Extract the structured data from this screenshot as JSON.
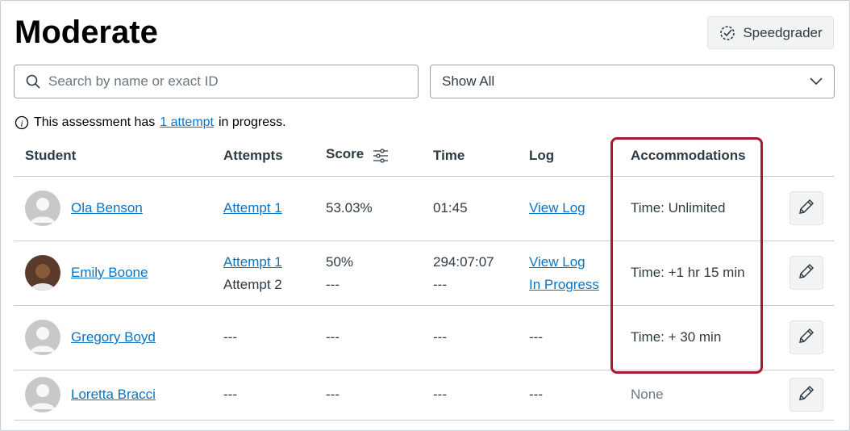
{
  "title": "Moderate",
  "speedgrader_label": "Speedgrader",
  "search": {
    "placeholder": "Search by name or exact ID",
    "value": ""
  },
  "filter": {
    "selected": "Show All"
  },
  "info": {
    "prefix": "This assessment has",
    "link": "1 attempt",
    "suffix": "in progress."
  },
  "columns": {
    "student": "Student",
    "attempts": "Attempts",
    "score": "Score",
    "time": "Time",
    "log": "Log",
    "accommodations": "Accommodations"
  },
  "rows": [
    {
      "name": "Ola Benson",
      "attempts": [
        "Attempt 1"
      ],
      "scores": [
        "53.03%"
      ],
      "times": [
        "01:45"
      ],
      "logs": [
        "View Log"
      ],
      "accommodation": "Time: Unlimited"
    },
    {
      "name": "Emily Boone",
      "attempts": [
        "Attempt 1",
        "Attempt 2"
      ],
      "scores": [
        "50%",
        "---"
      ],
      "times": [
        "294:07:07",
        "---"
      ],
      "logs": [
        "View Log",
        "In Progress"
      ],
      "accommodation": "Time: +1 hr 15 min"
    },
    {
      "name": "Gregory Boyd",
      "attempts": [
        "---"
      ],
      "scores": [
        "---"
      ],
      "times": [
        "---"
      ],
      "logs": [
        "---"
      ],
      "accommodation": "Time: + 30 min"
    },
    {
      "name": "Loretta Bracci",
      "attempts": [
        "---"
      ],
      "scores": [
        "---"
      ],
      "times": [
        "---"
      ],
      "logs": [
        "---"
      ],
      "accommodation": "None"
    }
  ],
  "colors": {
    "link": "#0b74c4",
    "highlight": "#a6192e"
  }
}
